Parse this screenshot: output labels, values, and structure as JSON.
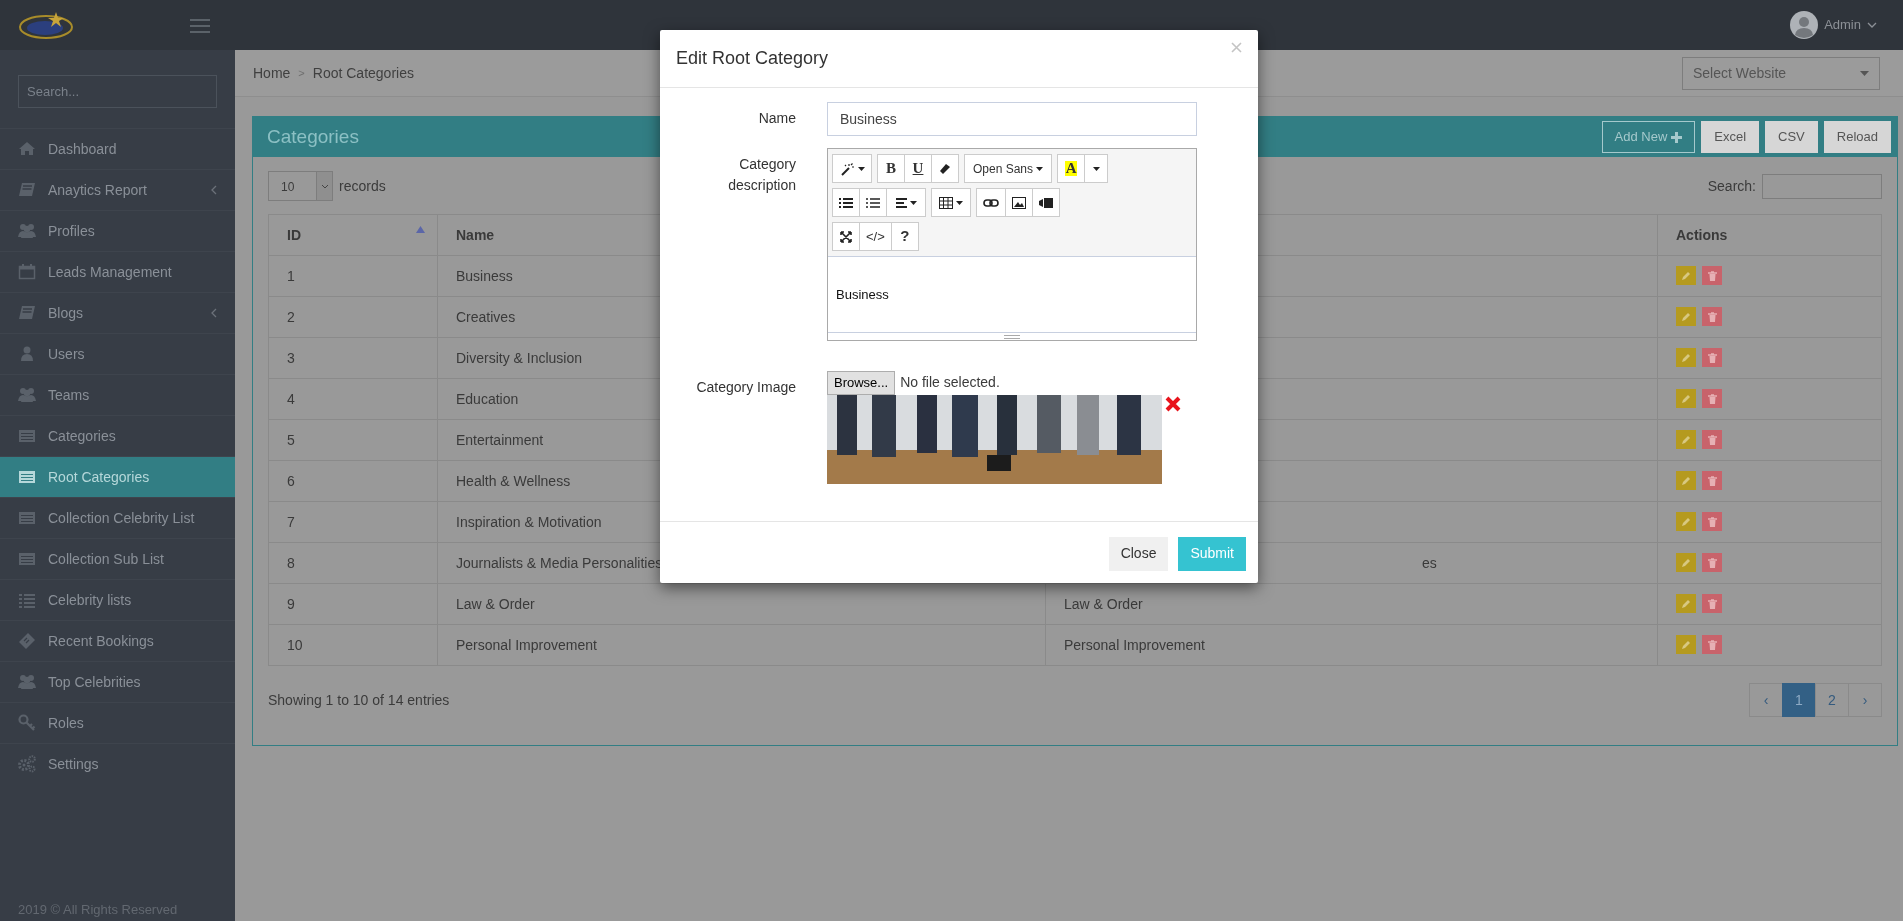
{
  "topbar": {
    "user": "Admin"
  },
  "sidebar": {
    "search_placeholder": "Search...",
    "items": [
      {
        "label": "Dashboard",
        "has_submenu": false,
        "selected": false
      },
      {
        "label": "Anaytics Report",
        "has_submenu": true,
        "selected": false
      },
      {
        "label": "Profiles",
        "has_submenu": false,
        "selected": false
      },
      {
        "label": "Leads Management",
        "has_submenu": false,
        "selected": false
      },
      {
        "label": "Blogs",
        "has_submenu": true,
        "selected": false
      },
      {
        "label": "Users",
        "has_submenu": false,
        "selected": false
      },
      {
        "label": "Teams",
        "has_submenu": false,
        "selected": false
      },
      {
        "label": "Categories",
        "has_submenu": false,
        "selected": false
      },
      {
        "label": "Root Categories",
        "has_submenu": false,
        "selected": true
      },
      {
        "label": "Collection Celebrity List",
        "has_submenu": false,
        "selected": false
      },
      {
        "label": "Collection Sub List",
        "has_submenu": false,
        "selected": false
      },
      {
        "label": "Celebrity lists",
        "has_submenu": false,
        "selected": false
      },
      {
        "label": "Recent Bookings",
        "has_submenu": false,
        "selected": false
      },
      {
        "label": "Top Celebrities",
        "has_submenu": false,
        "selected": false
      },
      {
        "label": "Roles",
        "has_submenu": false,
        "selected": false
      },
      {
        "label": "Settings",
        "has_submenu": false,
        "selected": false
      }
    ],
    "footer": "2019 © All Rights Reserved"
  },
  "breadcrumb": {
    "items": [
      "Home",
      "Root Categories"
    ],
    "separator": ">"
  },
  "website_select": {
    "placeholder": "Select Website"
  },
  "panel": {
    "title": "Categories",
    "buttons": [
      {
        "label": "Add New",
        "kind": "outline"
      },
      {
        "label": "Excel",
        "kind": "plain"
      },
      {
        "label": "CSV",
        "kind": "plain"
      },
      {
        "label": "Reload",
        "kind": "plain"
      }
    ],
    "length": {
      "value": "10",
      "label": "records"
    },
    "search_label": "Search:",
    "table": {
      "columns": [
        {
          "label": "ID",
          "sorted": true
        },
        {
          "label": "Name",
          "sorted": false
        },
        {
          "label": "Actions",
          "sorted": false
        }
      ],
      "rows": [
        {
          "id": "1",
          "name": "Business"
        },
        {
          "id": "2",
          "name": "Creatives"
        },
        {
          "id": "3",
          "name": "Diversity & Inclusion"
        },
        {
          "id": "4",
          "name": "Education"
        },
        {
          "id": "5",
          "name": "Entertainment"
        },
        {
          "id": "6",
          "name": "Health & Wellness"
        },
        {
          "id": "7",
          "name": "Inspiration & Motivation"
        },
        {
          "id": "8",
          "name": "Journalists & Media Personalities",
          "column_3": "es"
        },
        {
          "id": "9",
          "name": "Law & Order",
          "column_3": "Law & Order"
        },
        {
          "id": "10",
          "name": "Personal Improvement",
          "column_3": "Personal Improvement"
        }
      ]
    },
    "info": "Showing 1 to 10 of 14 entries",
    "pagination": [
      {
        "label": "‹",
        "selected": false
      },
      {
        "label": "1",
        "selected": true
      },
      {
        "label": "2",
        "selected": false
      },
      {
        "label": "›",
        "selected": false
      }
    ]
  },
  "modal": {
    "title": "Edit Root Category",
    "fields": [
      {
        "label": "Name",
        "kind": "text",
        "value": "Business"
      },
      {
        "label": "Category description",
        "kind": "editor",
        "content": "Business",
        "toolbar": [
          [
            [
              {
                "kind": "magic"
              }
            ],
            [
              {
                "kind": "bold",
                "label": "B"
              },
              {
                "kind": "underline",
                "label": "U"
              },
              {
                "kind": "eraser"
              }
            ],
            [
              {
                "kind": "font",
                "label": "Open Sans"
              }
            ],
            [
              {
                "kind": "color",
                "label": "A"
              },
              {
                "kind": "caret"
              }
            ]
          ],
          [
            [
              {
                "kind": "ul"
              },
              {
                "kind": "ol"
              },
              {
                "kind": "align"
              }
            ],
            [
              {
                "kind": "table"
              }
            ],
            [
              {
                "kind": "link"
              },
              {
                "kind": "picture"
              },
              {
                "kind": "video"
              }
            ]
          ],
          [
            [
              {
                "kind": "fullscreen"
              },
              {
                "kind": "code",
                "label": "</>"
              },
              {
                "kind": "help",
                "label": "?"
              }
            ]
          ]
        ]
      },
      {
        "label": "Category Image",
        "kind": "file",
        "button": "Browse...",
        "status": "No file selected."
      }
    ],
    "buttons": [
      {
        "label": "Close",
        "kind": "secondary"
      },
      {
        "label": "Submit",
        "kind": "primary"
      }
    ]
  }
}
